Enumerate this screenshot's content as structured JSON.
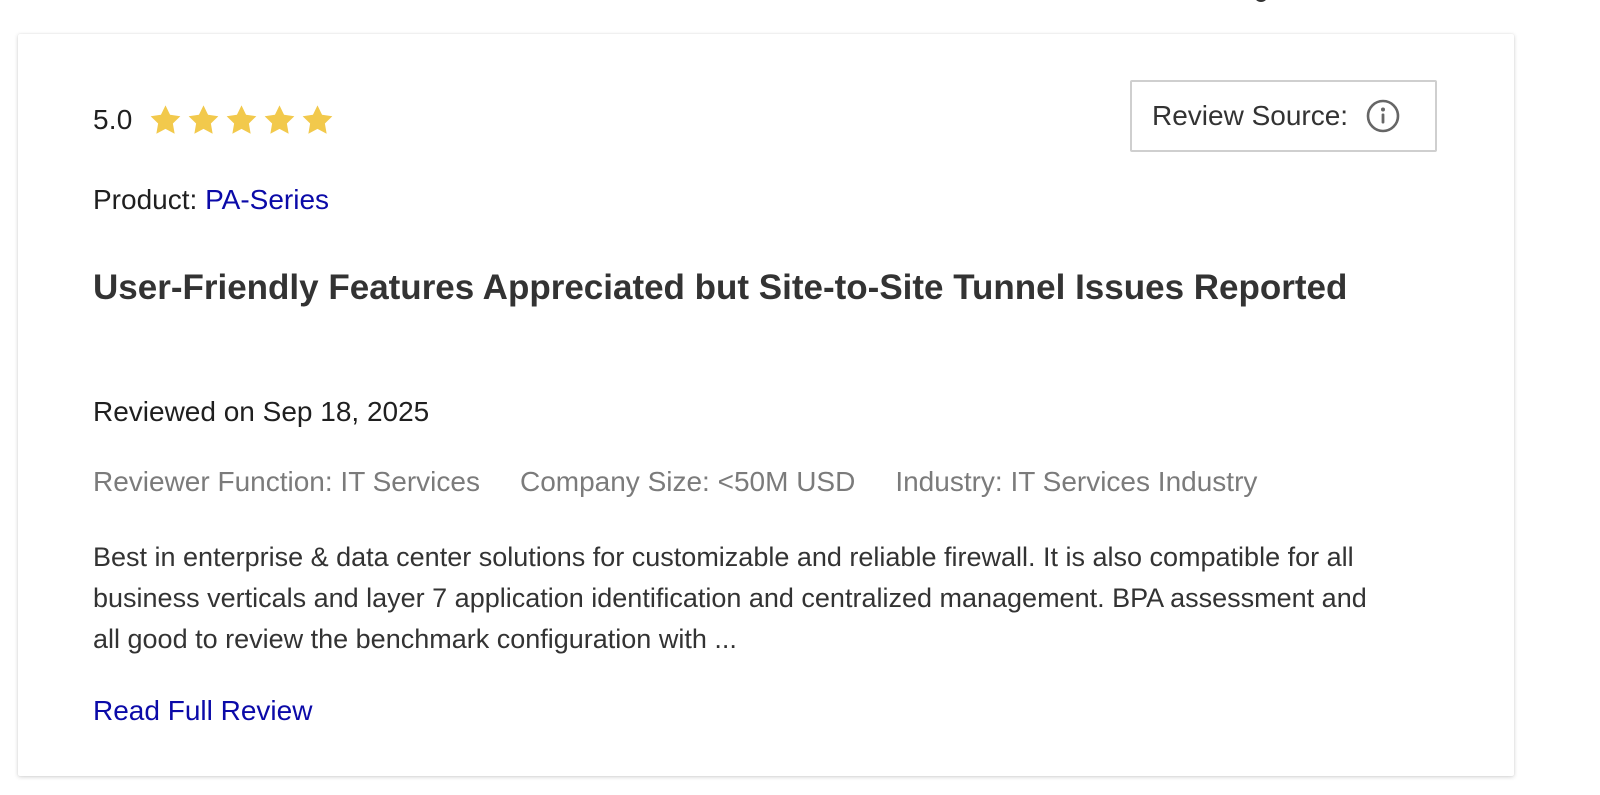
{
  "review": {
    "rating_value": "5.0",
    "rating_stars": 5,
    "star_color": "#F2C94C",
    "review_source_label": "Review Source:",
    "product_label": "Product:",
    "product_name": "PA-Series",
    "title": "User-Friendly Features Appreciated but Site-to-Site Tunnel Issues Reported",
    "reviewed_on": "Reviewed on Sep 18, 2025",
    "meta": {
      "reviewer_function": "Reviewer Function: IT Services",
      "company_size": "Company Size: <50M USD",
      "industry": "Industry: IT Services Industry"
    },
    "excerpt": "Best in enterprise & data center solutions for customizable and reliable firewall. It is also compatible for all business verticals and layer 7 application identification and centralized management. BPA assessment and all good to review the benchmark configuration with ...",
    "read_full_review_label": "Read Full Review",
    "link_color": "#0B0AA8"
  },
  "icons": {
    "rating": "star-icon",
    "review_source": "info-icon"
  }
}
